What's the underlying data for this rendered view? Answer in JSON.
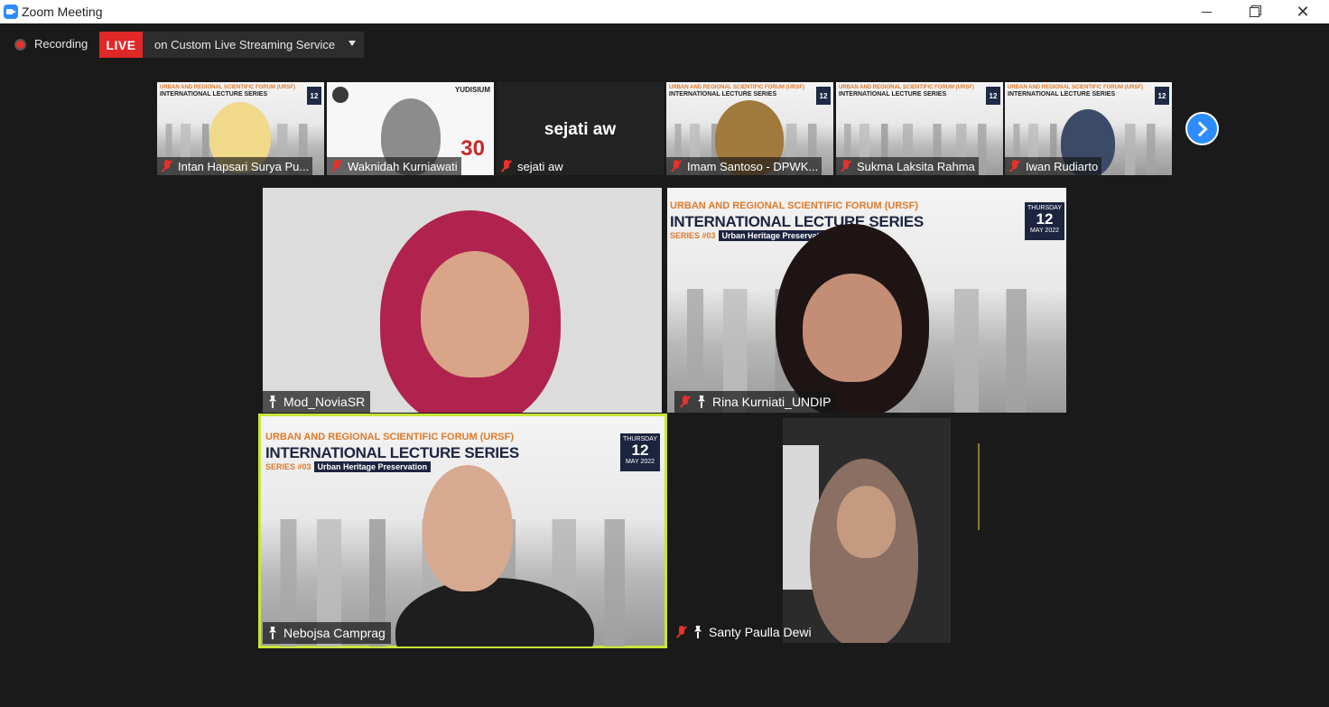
{
  "window": {
    "title": "Zoom Meeting",
    "close_glyph": "✕"
  },
  "recording": {
    "label": "Recording",
    "live_badge": "LIVE",
    "stream_target": "on Custom Live Streaming Service"
  },
  "thumbnails": [
    {
      "name": "Intan Hapsari Surya Pu...",
      "muted": true
    },
    {
      "name": "Waknidah Kurniawati",
      "muted": true,
      "slide_label": "YUDISIUM"
    },
    {
      "name": "sejati aw",
      "muted": true,
      "display_name": "sejati aw"
    },
    {
      "name": "Imam Santoso - DPWK...",
      "muted": true
    },
    {
      "name": "Sukma Laksita Rahma",
      "muted": true
    },
    {
      "name": "Iwan Rudiarto",
      "muted": true
    }
  ],
  "slide": {
    "forum": "URBAN AND REGIONAL SCIENTIFIC FORUM (URSF)",
    "title": "INTERNATIONAL LECTURE SERIES",
    "series": "SERIES #03",
    "topic": "Urban Heritage Preservation",
    "weekday": "THURSDAY",
    "day": "12",
    "month": "MAY 2022",
    "short_forum": "URBAN AND REGIONAL SCIENTIFIC FORUM (URSF)",
    "short_title": "INTERNATIONAL LECTURE SERIES",
    "short_topic": "Urban Heritage Preservation"
  },
  "tiles": [
    {
      "name": "Mod_NoviaSR",
      "pinned": true
    },
    {
      "name": "Rina Kurniati_UNDIP",
      "pinned": true,
      "muted": true
    },
    {
      "name": "Nebojsa Camprag",
      "pinned": true,
      "active": true
    },
    {
      "name": "Santy Paulla Dewi",
      "pinned": true,
      "muted": true
    }
  ],
  "colors": {
    "accent": "#2d8cff",
    "live": "#e02828",
    "active_speaker": "#c9e53a",
    "muted": "#e8312a"
  }
}
